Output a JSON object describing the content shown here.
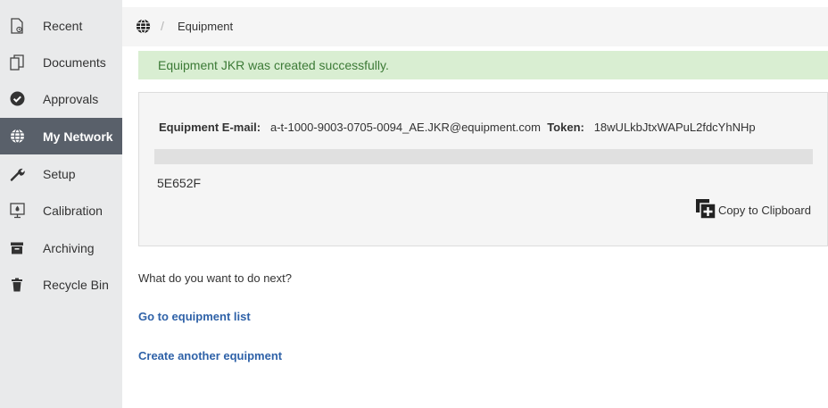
{
  "sidebar": {
    "items": [
      {
        "label": "Recent",
        "icon": "recent-file-icon",
        "active": false
      },
      {
        "label": "Documents",
        "icon": "documents-icon",
        "active": false
      },
      {
        "label": "Approvals",
        "icon": "check-circle-icon",
        "active": false
      },
      {
        "label": "My Network",
        "icon": "globe-icon",
        "active": true
      },
      {
        "label": "Setup",
        "icon": "wrench-icon",
        "active": false
      },
      {
        "label": "Calibration",
        "icon": "calibration-icon",
        "active": false
      },
      {
        "label": "Archiving",
        "icon": "archive-icon",
        "active": false
      },
      {
        "label": "Recycle Bin",
        "icon": "trash-icon",
        "active": false
      }
    ]
  },
  "breadcrumb": {
    "separator": "/",
    "current": "Equipment"
  },
  "alert": {
    "message": "Equipment JKR was created successfully."
  },
  "credentials": {
    "email_label": "Equipment E-mail:",
    "email_value": "a-t-1000-9003-0705-0094_AE.JKR@equipment.com",
    "token_label": "Token:",
    "token_value": "18wULkbJtxWAPuL2fdcYhNHp",
    "code": "5E652F",
    "copy_label": "Copy to Clipboard"
  },
  "next": {
    "question": "What do you want to do next?",
    "go_to_list": "Go to equipment list",
    "create_another": "Create another equipment"
  },
  "colors": {
    "sidebar_bg": "#e9eaeb",
    "active_bg": "#59606a",
    "alert_bg": "#d9eed2",
    "alert_text": "#3c7a36",
    "link": "#2f62a8"
  }
}
